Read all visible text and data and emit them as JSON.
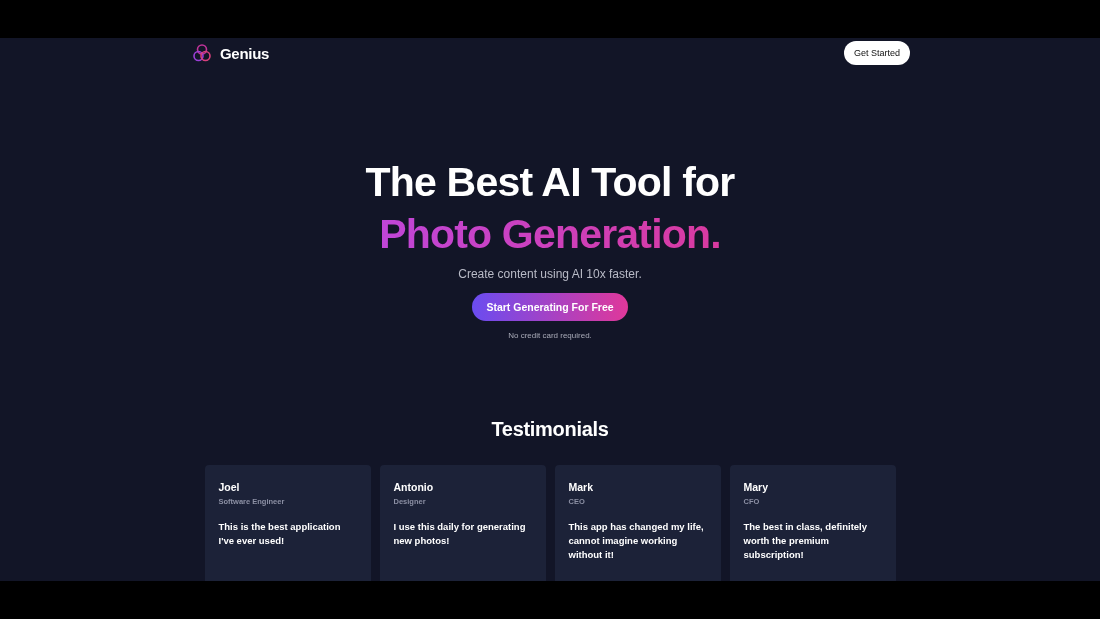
{
  "nav": {
    "brand": "Genius",
    "cta": "Get Started"
  },
  "hero": {
    "title": "The Best AI Tool for",
    "highlight": "Photo Generation.",
    "subtitle": "Create content using AI 10x faster.",
    "button": "Start Generating For Free",
    "note": "No credit card required."
  },
  "testimonials": {
    "title": "Testimonials",
    "items": [
      {
        "name": "Joel",
        "role": "Software Engineer",
        "text": "This is the best application I've ever used!"
      },
      {
        "name": "Antonio",
        "role": "Designer",
        "text": "I use this daily for generating new photos!"
      },
      {
        "name": "Mark",
        "role": "CEO",
        "text": "This app has changed my life, cannot imagine working without it!"
      },
      {
        "name": "Mary",
        "role": "CFO",
        "text": "The best in class, definitely worth the premium subscription!"
      }
    ]
  }
}
